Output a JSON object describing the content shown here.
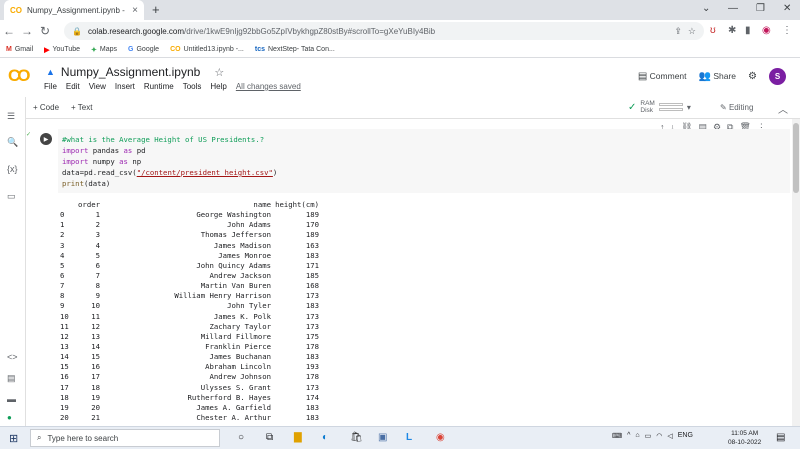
{
  "browser": {
    "tab_title": "Numpy_Assignment.ipynb - Cola",
    "tab_close": "×",
    "new_tab": "+",
    "url_host": "colab.research.google.com",
    "url_path": "/drive/1kwE9nIjg92bbGo5ZpIVbykhgpZ80stBy#scrollTo=gXeYuBIy4Bib",
    "bookmarks": [
      "Gmail",
      "YouTube",
      "Maps",
      "Google",
      "Untitled13.ipynb -...",
      "NextStep- Tata Con..."
    ]
  },
  "colab": {
    "notebook_title": "Numpy_Assignment.ipynb",
    "menus": [
      "File",
      "Edit",
      "View",
      "Insert",
      "Runtime",
      "Tools",
      "Help"
    ],
    "saved_status": "All changes saved",
    "comment_label": "Comment",
    "share_label": "Share",
    "avatar_letter": "S",
    "add_code": "+ Code",
    "add_text": "+ Text",
    "ram_label": "RAM",
    "disk_label": "Disk",
    "editing_label": "Editing"
  },
  "cell": {
    "lines": [
      "#what is the Average Height of US Presidents.?",
      "import pandas as pd",
      "import numpy as np",
      "data=pd.read_csv(\"/content/president_height.csv\")",
      "print(data)"
    ]
  },
  "output": {
    "header": {
      "order": "order",
      "name": "name",
      "height": "height(cm)"
    },
    "rows": [
      [
        "0",
        "1",
        "George Washington",
        "189"
      ],
      [
        "1",
        "2",
        "John Adams",
        "170"
      ],
      [
        "2",
        "3",
        "Thomas Jefferson",
        "189"
      ],
      [
        "3",
        "4",
        "James Madison",
        "163"
      ],
      [
        "4",
        "5",
        "James Monroe",
        "183"
      ],
      [
        "5",
        "6",
        "John Quincy Adams",
        "171"
      ],
      [
        "6",
        "7",
        "Andrew Jackson",
        "185"
      ],
      [
        "7",
        "8",
        "Martin Van Buren",
        "168"
      ],
      [
        "8",
        "9",
        "William Henry Harrison",
        "173"
      ],
      [
        "9",
        "10",
        "John Tyler",
        "183"
      ],
      [
        "10",
        "11",
        "James K. Polk",
        "173"
      ],
      [
        "11",
        "12",
        "Zachary Taylor",
        "173"
      ],
      [
        "12",
        "13",
        "Millard Fillmore",
        "175"
      ],
      [
        "13",
        "14",
        "Franklin Pierce",
        "178"
      ],
      [
        "14",
        "15",
        "James Buchanan",
        "183"
      ],
      [
        "15",
        "16",
        "Abraham Lincoln",
        "193"
      ],
      [
        "16",
        "17",
        "Andrew Johnson",
        "178"
      ],
      [
        "17",
        "18",
        "Ulysses S. Grant",
        "173"
      ],
      [
        "18",
        "19",
        "Rutherford B. Hayes",
        "174"
      ],
      [
        "19",
        "20",
        "James A. Garfield",
        "183"
      ],
      [
        "20",
        "21",
        "Chester A. Arthur",
        "183"
      ]
    ]
  },
  "taskbar": {
    "search_placeholder": "Type here to search",
    "language": "ENG",
    "time": "11:05 AM",
    "date": "08-10-2022"
  }
}
